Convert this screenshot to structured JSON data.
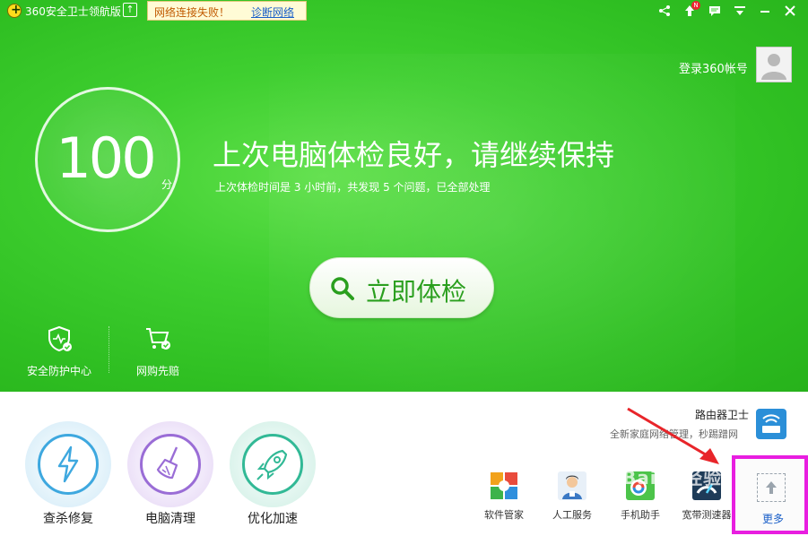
{
  "titlebar": {
    "app_title": "360安全卫士领航版",
    "network_warning": "网络连接失败！",
    "network_diagnose": "诊断网络",
    "icons": [
      "share-icon",
      "upgrade-icon",
      "message-icon",
      "menu-icon",
      "minimize-icon",
      "close-icon"
    ],
    "badge": "N"
  },
  "account": {
    "login_label": "登录360帐号"
  },
  "score": {
    "value": "100",
    "unit": "分"
  },
  "status": {
    "headline": "上次电脑体检良好，请继续保持",
    "detail": "上次体检时间是 3 小时前，共发现 5 个问题，已全部处理"
  },
  "scan_button": {
    "label": "立即体检"
  },
  "shortcuts": [
    {
      "label": "安全防护中心",
      "icon": "shield-icon"
    },
    {
      "label": "网购先赔",
      "icon": "shopping-cart-icon"
    }
  ],
  "router": {
    "title": "路由器卫士",
    "desc": "全新家庭网络管理，秒踢蹭网"
  },
  "tools": [
    {
      "label": "查杀修复",
      "icon": "lightning-icon"
    },
    {
      "label": "电脑清理",
      "icon": "broom-icon"
    },
    {
      "label": "优化加速",
      "icon": "rocket-icon"
    }
  ],
  "apps": [
    {
      "label": "软件管家",
      "icon": "software-manager-icon"
    },
    {
      "label": "人工服务",
      "icon": "service-agent-icon"
    },
    {
      "label": "手机助手",
      "icon": "phone-assistant-icon"
    },
    {
      "label": "宽带测速器",
      "icon": "speed-test-icon"
    }
  ],
  "more": {
    "label": "更多"
  },
  "watermark": "Baidu经验",
  "colors": {
    "brand_green": "#3fcf30",
    "highlight": "#e81ee0",
    "link_blue": "#1a5fc8",
    "arrow_red": "#e8252a"
  }
}
